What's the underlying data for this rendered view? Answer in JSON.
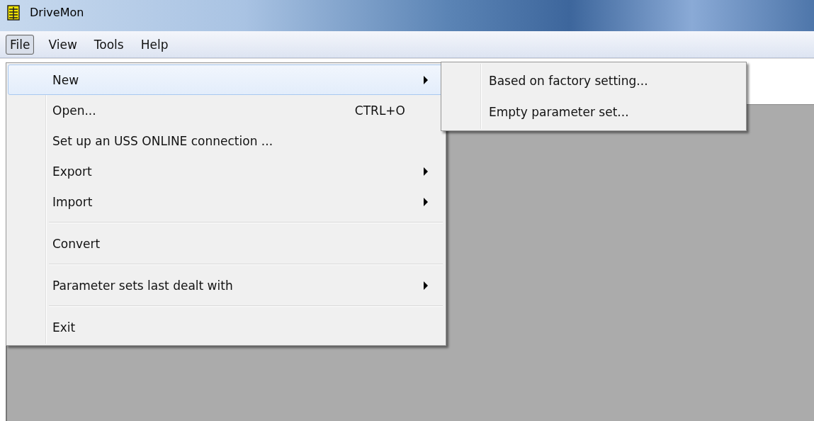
{
  "window": {
    "title": "DriveMon"
  },
  "menu_bar": [
    {
      "label": "File",
      "selected": true
    },
    {
      "label": "View",
      "selected": false
    },
    {
      "label": "Tools",
      "selected": false
    },
    {
      "label": "Help",
      "selected": false
    }
  ],
  "file_menu": [
    {
      "kind": "item",
      "label": "New",
      "selected": true,
      "submenu": true
    },
    {
      "kind": "item",
      "label": "Open...",
      "shortcut": "CTRL+O",
      "selected": false,
      "submenu": false
    },
    {
      "kind": "item",
      "label": "Set up an USS ONLINE connection ...",
      "selected": false,
      "submenu": false
    },
    {
      "kind": "item",
      "label": "Export",
      "selected": false,
      "submenu": true
    },
    {
      "kind": "item",
      "label": "Import",
      "selected": false,
      "submenu": true
    },
    {
      "kind": "separator"
    },
    {
      "kind": "item",
      "label": "Convert",
      "selected": false,
      "submenu": false
    },
    {
      "kind": "separator"
    },
    {
      "kind": "item",
      "label": "Parameter sets last dealt with",
      "selected": false,
      "submenu": true
    },
    {
      "kind": "separator"
    },
    {
      "kind": "item",
      "label": "Exit",
      "selected": false,
      "submenu": false
    }
  ],
  "new_submenu": [
    {
      "label": "Based on factory setting...",
      "selected": false
    },
    {
      "label": "Empty parameter set...",
      "selected": false
    }
  ]
}
